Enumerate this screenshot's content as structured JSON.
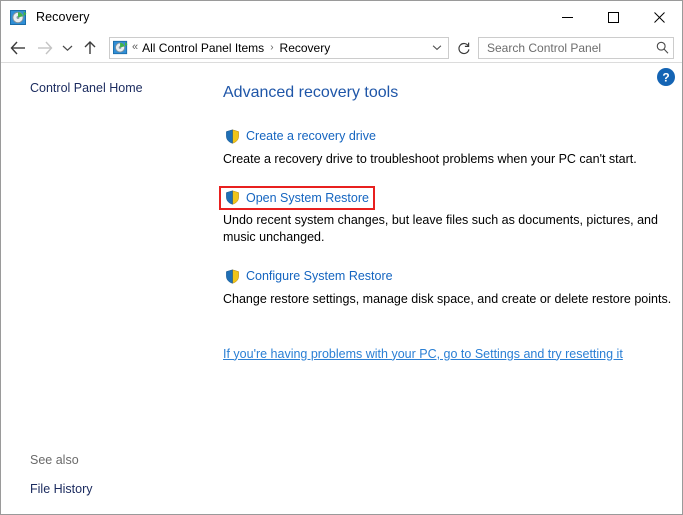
{
  "window": {
    "title": "Recovery",
    "title_icon": "recovery-icon",
    "minimize_label": "–",
    "maximize_label": "☐",
    "close_label": "✕"
  },
  "toolbar": {
    "back_icon": "back-arrow-icon",
    "forward_icon": "forward-arrow-icon",
    "recent_icon": "chevron-down-icon",
    "up_icon": "up-arrow-icon",
    "refresh_icon": "refresh-icon",
    "dropdown_icon": "chevron-down-icon"
  },
  "address": {
    "icon": "recovery-icon",
    "overflow": "«",
    "separator": "›",
    "crumbs": [
      {
        "label": "All Control Panel Items"
      },
      {
        "label": "Recovery"
      }
    ]
  },
  "search": {
    "placeholder": "Search Control Panel",
    "value": "",
    "icon": "search-icon"
  },
  "sidebar": {
    "home_label": "Control Panel Home",
    "see_also_label": "See also",
    "see_also_items": [
      {
        "label": "File History"
      }
    ]
  },
  "main": {
    "heading": "Advanced recovery tools",
    "help_icon": "help-icon",
    "tools": [
      {
        "link": "Create a recovery drive",
        "description": "Create a recovery drive to troubleshoot problems when your PC can't start.",
        "icon": "uac-shield-icon",
        "highlighted": false
      },
      {
        "link": "Open System Restore",
        "description": "Undo recent system changes, but leave files such as documents, pictures, and music unchanged.",
        "icon": "uac-shield-icon",
        "highlighted": true
      },
      {
        "link": "Configure System Restore",
        "description": "Change restore settings, manage disk space, and create or delete restore points.",
        "icon": "uac-shield-icon",
        "highlighted": false
      }
    ],
    "settings_link": "If you're having problems with your PC, go to Settings and try resetting it"
  },
  "colors": {
    "heading_blue": "#1f56a8",
    "link_blue": "#1565c0",
    "settings_link_blue": "#2a7fd4",
    "sidebar_navy": "#1a2a5e",
    "highlight_red": "#e8201f",
    "help_blue": "#1464b4"
  }
}
